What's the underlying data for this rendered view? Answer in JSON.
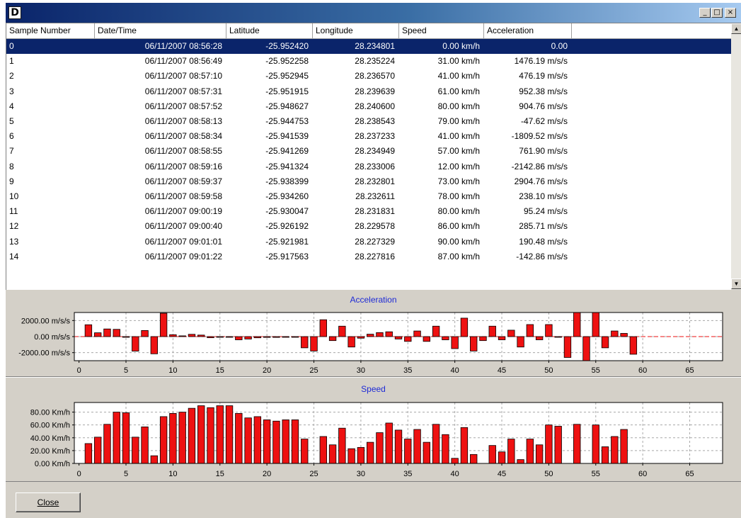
{
  "window": {
    "icon_letter": "D",
    "minimize_glyph": "_",
    "maximize_glyph": "□",
    "close_glyph": "×"
  },
  "table": {
    "columns": [
      "Sample Number",
      "Date/Time",
      "Latitude",
      "Longitude",
      "Speed",
      "Acceleration"
    ],
    "rows": [
      [
        "0",
        "06/11/2007 08:56:28",
        "-25.952420",
        "28.234801",
        "0.00 km/h",
        "0.00"
      ],
      [
        "1",
        "06/11/2007 08:56:49",
        "-25.952258",
        "28.235224",
        "31.00 km/h",
        "1476.19 m/s/s"
      ],
      [
        "2",
        "06/11/2007 08:57:10",
        "-25.952945",
        "28.236570",
        "41.00 km/h",
        "476.19 m/s/s"
      ],
      [
        "3",
        "06/11/2007 08:57:31",
        "-25.951915",
        "28.239639",
        "61.00 km/h",
        "952.38 m/s/s"
      ],
      [
        "4",
        "06/11/2007 08:57:52",
        "-25.948627",
        "28.240600",
        "80.00 km/h",
        "904.76 m/s/s"
      ],
      [
        "5",
        "06/11/2007 08:58:13",
        "-25.944753",
        "28.238543",
        "79.00 km/h",
        "-47.62 m/s/s"
      ],
      [
        "6",
        "06/11/2007 08:58:34",
        "-25.941539",
        "28.237233",
        "41.00 km/h",
        "-1809.52 m/s/s"
      ],
      [
        "7",
        "06/11/2007 08:58:55",
        "-25.941269",
        "28.234949",
        "57.00 km/h",
        "761.90 m/s/s"
      ],
      [
        "8",
        "06/11/2007 08:59:16",
        "-25.941324",
        "28.233006",
        "12.00 km/h",
        "-2142.86 m/s/s"
      ],
      [
        "9",
        "06/11/2007 08:59:37",
        "-25.938399",
        "28.232801",
        "73.00 km/h",
        "2904.76 m/s/s"
      ],
      [
        "10",
        "06/11/2007 08:59:58",
        "-25.934260",
        "28.232611",
        "78.00 km/h",
        "238.10 m/s/s"
      ],
      [
        "11",
        "06/11/2007 09:00:19",
        "-25.930047",
        "28.231831",
        "80.00 km/h",
        "95.24 m/s/s"
      ],
      [
        "12",
        "06/11/2007 09:00:40",
        "-25.926192",
        "28.229578",
        "86.00 km/h",
        "285.71 m/s/s"
      ],
      [
        "13",
        "06/11/2007 09:01:01",
        "-25.921981",
        "28.227329",
        "90.00 km/h",
        "190.48 m/s/s"
      ],
      [
        "14",
        "06/11/2007 09:01:22",
        "-25.917563",
        "28.227816",
        "87.00 km/h",
        "-142.86 m/s/s"
      ]
    ],
    "selected_row": 0
  },
  "colors": {
    "bar_fill": "#ee1111",
    "bar_stroke": "#000000",
    "title_color": "#1e2ad6",
    "selection": "#0a246a",
    "zero_line": "#ee1111"
  },
  "close_button": {
    "label": "Close"
  },
  "chart_data": [
    {
      "type": "bar",
      "title": "Acceleration",
      "ylim": [
        -3000,
        3000
      ],
      "yticks": [
        {
          "value": 2000,
          "label": "2000.00 m/s/s"
        },
        {
          "value": 0,
          "label": "0.00 m/s/s"
        },
        {
          "value": -2000,
          "label": "-2000.00 m/s/s"
        }
      ],
      "xlim": [
        -0.5,
        68.5
      ],
      "xticks": [
        0,
        5,
        10,
        15,
        20,
        25,
        30,
        35,
        40,
        45,
        50,
        55,
        60,
        65
      ],
      "grid": true,
      "x": [
        1,
        2,
        3,
        4,
        5,
        6,
        7,
        8,
        9,
        10,
        11,
        12,
        13,
        14,
        15,
        16,
        17,
        18,
        19,
        20,
        21,
        22,
        23,
        24,
        25,
        26,
        27,
        28,
        29,
        30,
        31,
        32,
        33,
        34,
        35,
        36,
        37,
        38,
        39,
        40,
        41,
        42,
        43,
        44,
        45,
        46,
        47,
        48,
        49,
        50,
        51,
        52,
        53,
        54,
        55,
        56,
        57,
        58,
        59
      ],
      "values": [
        1476.19,
        476.19,
        952.38,
        904.76,
        -47.62,
        -1809.52,
        761.9,
        -2142.86,
        2904.76,
        238.1,
        95.24,
        285.71,
        190.48,
        -142.86,
        0,
        0,
        -400,
        -300,
        -150,
        -100,
        -100,
        -80,
        -80,
        -1400,
        -1800,
        2100,
        -500,
        1300,
        -1300,
        -200,
        300,
        500,
        600,
        -300,
        -600,
        700,
        -600,
        1300,
        -400,
        -1500,
        2300,
        -1800,
        -500,
        1300,
        -400,
        800,
        -1300,
        1500,
        -400,
        1500,
        0,
        -2600,
        3000,
        -3000,
        3000,
        -1400,
        700,
        400,
        -2200
      ]
    },
    {
      "type": "bar",
      "title": "Speed",
      "ylim": [
        0,
        95
      ],
      "yticks": [
        {
          "value": 80,
          "label": "80.00 Km/h"
        },
        {
          "value": 60,
          "label": "60.00 Km/h"
        },
        {
          "value": 40,
          "label": "40.00 Km/h"
        },
        {
          "value": 20,
          "label": "20.00 Km/h"
        },
        {
          "value": 0,
          "label": "0.00 Km/h"
        }
      ],
      "xlim": [
        -0.5,
        68.5
      ],
      "xticks": [
        0,
        5,
        10,
        15,
        20,
        25,
        30,
        35,
        40,
        45,
        50,
        55,
        60,
        65
      ],
      "grid": true,
      "x": [
        1,
        2,
        3,
        4,
        5,
        6,
        7,
        8,
        9,
        10,
        11,
        12,
        13,
        14,
        15,
        16,
        17,
        18,
        19,
        20,
        21,
        22,
        23,
        24,
        26,
        27,
        28,
        29,
        30,
        31,
        32,
        33,
        34,
        35,
        36,
        37,
        38,
        39,
        40,
        41,
        42,
        44,
        45,
        46,
        47,
        48,
        49,
        50,
        51,
        53,
        55,
        56,
        57,
        58
      ],
      "values": [
        31,
        41,
        61,
        80,
        79,
        41,
        57,
        12,
        73,
        78,
        80,
        86,
        90,
        87,
        90,
        90,
        78,
        71,
        73,
        68,
        66,
        68,
        68,
        38,
        42,
        29,
        55,
        23,
        25,
        33,
        48,
        63,
        52,
        38,
        53,
        33,
        61,
        45,
        8,
        56,
        14,
        28,
        18,
        38,
        6,
        38,
        29,
        60,
        58,
        61,
        60,
        26,
        42,
        53
      ]
    }
  ]
}
